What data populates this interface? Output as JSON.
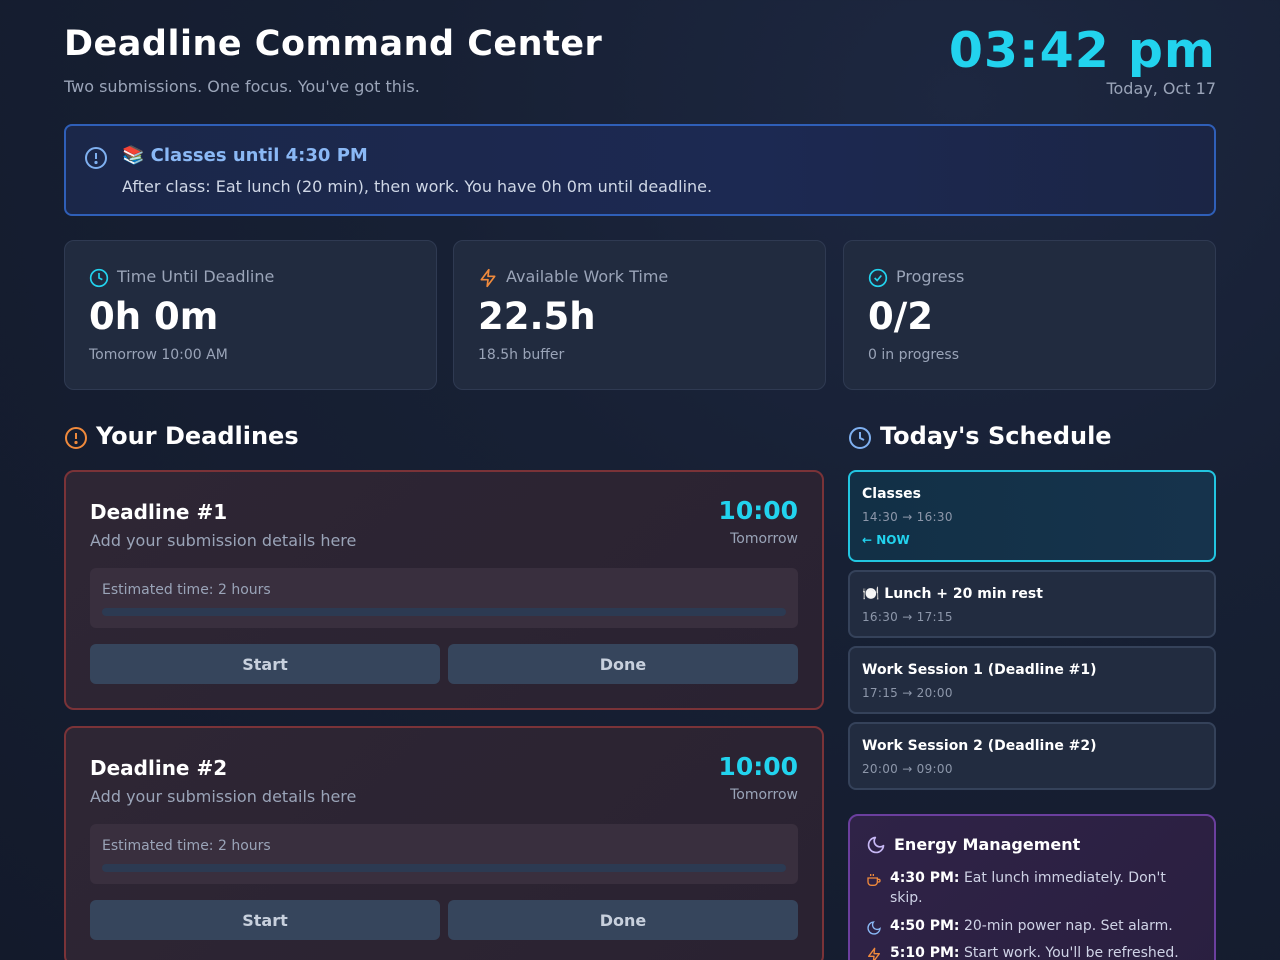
{
  "header": {
    "title": "Deadline Command Center",
    "subtitle": "Two submissions. One focus. You've got this.",
    "clock": "03:42 pm",
    "date": "Today, Oct 17"
  },
  "alert": {
    "title": "📚 Classes until 4:30 PM",
    "text": "After class: Eat lunch (20 min), then work. You have 0h 0m until deadline."
  },
  "stats": [
    {
      "label": "Time Until Deadline",
      "value": "0h 0m",
      "sub": "Tomorrow 10:00 AM",
      "icon": "clock-icon",
      "color": "#22d3ee"
    },
    {
      "label": "Available Work Time",
      "value": "22.5h",
      "sub": "18.5h buffer",
      "icon": "bolt-icon",
      "color": "#f08a3c"
    },
    {
      "label": "Progress",
      "value": "0/2",
      "sub": "0 in progress",
      "icon": "check-circle-icon",
      "color": "#22d3ee"
    }
  ],
  "deadlines_section": {
    "title": "Your Deadlines"
  },
  "deadlines": [
    {
      "title": "Deadline #1",
      "desc": "Add your submission details here",
      "time": "10:00",
      "when": "Tomorrow",
      "estimate": "Estimated time: 2 hours",
      "progress": 0,
      "start_label": "Start",
      "done_label": "Done"
    },
    {
      "title": "Deadline #2",
      "desc": "Add your submission details here",
      "time": "10:00",
      "when": "Tomorrow",
      "estimate": "Estimated time: 2 hours",
      "progress": 0,
      "start_label": "Start",
      "done_label": "Done"
    }
  ],
  "schedule_section": {
    "title": "Today's Schedule"
  },
  "schedule": [
    {
      "title": "Classes",
      "time": "14:30 → 16:30",
      "now": "← NOW",
      "active": true
    },
    {
      "title": "🍽️ Lunch + 20 min rest",
      "time": "16:30 → 17:15",
      "active": false
    },
    {
      "title": "Work Session 1 (Deadline #1)",
      "time": "17:15 → 20:00",
      "active": false
    },
    {
      "title": "Work Session 2 (Deadline #2)",
      "time": "20:00 → 09:00",
      "active": false
    }
  ],
  "energy": {
    "title": "Energy Management",
    "tips": [
      {
        "time": "4:30 PM:",
        "text": " Eat lunch immediately. Don't skip.",
        "icon": "coffee-icon"
      },
      {
        "time": "4:50 PM:",
        "text": " 20-min power nap. Set alarm.",
        "icon": "moon-icon"
      },
      {
        "time": "5:10 PM:",
        "text": " Start work. You'll be refreshed.",
        "icon": "bolt-icon"
      }
    ]
  },
  "colors": {
    "accent": "#22d3ee",
    "alert_border": "#2f5fb8",
    "deadline_border": "#7a3338",
    "energy_border": "#6b3f9e"
  }
}
